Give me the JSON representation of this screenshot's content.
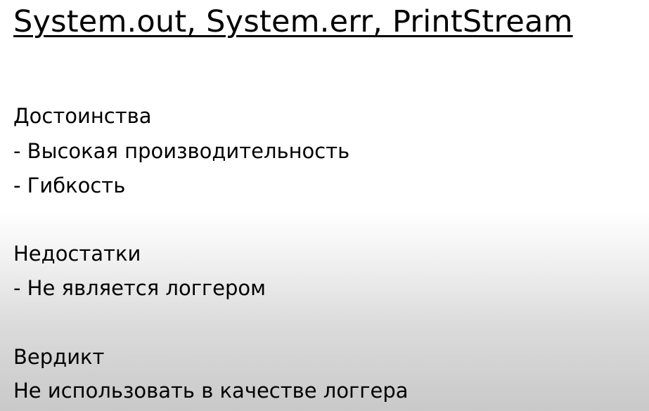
{
  "slide": {
    "title": "System.out, System.err, PrintStream",
    "advantages": {
      "heading": "Достоинства",
      "items": [
        "- Высокая производительность",
        "- Гибкость"
      ]
    },
    "disadvantages": {
      "heading": "Недостатки",
      "items": [
        "- Не является логгером"
      ]
    },
    "verdict": {
      "heading": "Вердикт",
      "text": "Не использовать в качестве логгера"
    }
  }
}
